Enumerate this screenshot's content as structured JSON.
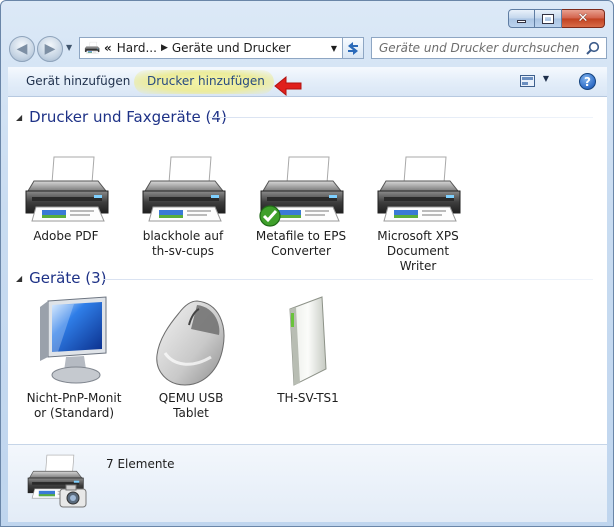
{
  "window": {
    "caption_buttons": [
      "minimize-icon",
      "maximize-icon",
      "close-icon"
    ]
  },
  "navigation": {
    "back_icon": "back-arrow-icon",
    "forward_icon": "forward-arrow-icon",
    "address": {
      "prefix": "«",
      "crumb_1": "Hard...",
      "crumb_2": "Geräte und Drucker"
    },
    "search_placeholder": "Geräte und Drucker durchsuchen"
  },
  "toolbar": {
    "add_device_label": "Gerät hinzufügen",
    "add_printer_label": "Drucker hinzufügen",
    "highlight_color": "#eeee9e",
    "arrow_color": "#e0201c"
  },
  "groups": {
    "printers": {
      "title": "Drucker und Faxgeräte (4)",
      "items": [
        {
          "line1": "Adobe PDF",
          "line2": "",
          "icon": "printer-icon",
          "default": false
        },
        {
          "line1": "blackhole auf",
          "line2": "th-sv-cups",
          "icon": "printer-icon",
          "default": false
        },
        {
          "line1": "Metafile to EPS",
          "line2": "Converter",
          "icon": "printer-icon",
          "default": true
        },
        {
          "line1": "Microsoft XPS",
          "line2": "Document Writer",
          "icon": "printer-icon",
          "default": false
        }
      ]
    },
    "devices": {
      "title": "Geräte (3)",
      "items": [
        {
          "line1": "Nicht-PnP-Monit",
          "line2": "or (Standard)",
          "icon": "monitor-icon"
        },
        {
          "line1": "QEMU USB",
          "line2": "Tablet",
          "icon": "mouse-icon"
        },
        {
          "line1": "TH-SV-TS1",
          "line2": "",
          "icon": "computer-tower-icon"
        }
      ]
    }
  },
  "details": {
    "count_label": "7 Elemente",
    "icon": "devices-printers-icon"
  }
}
